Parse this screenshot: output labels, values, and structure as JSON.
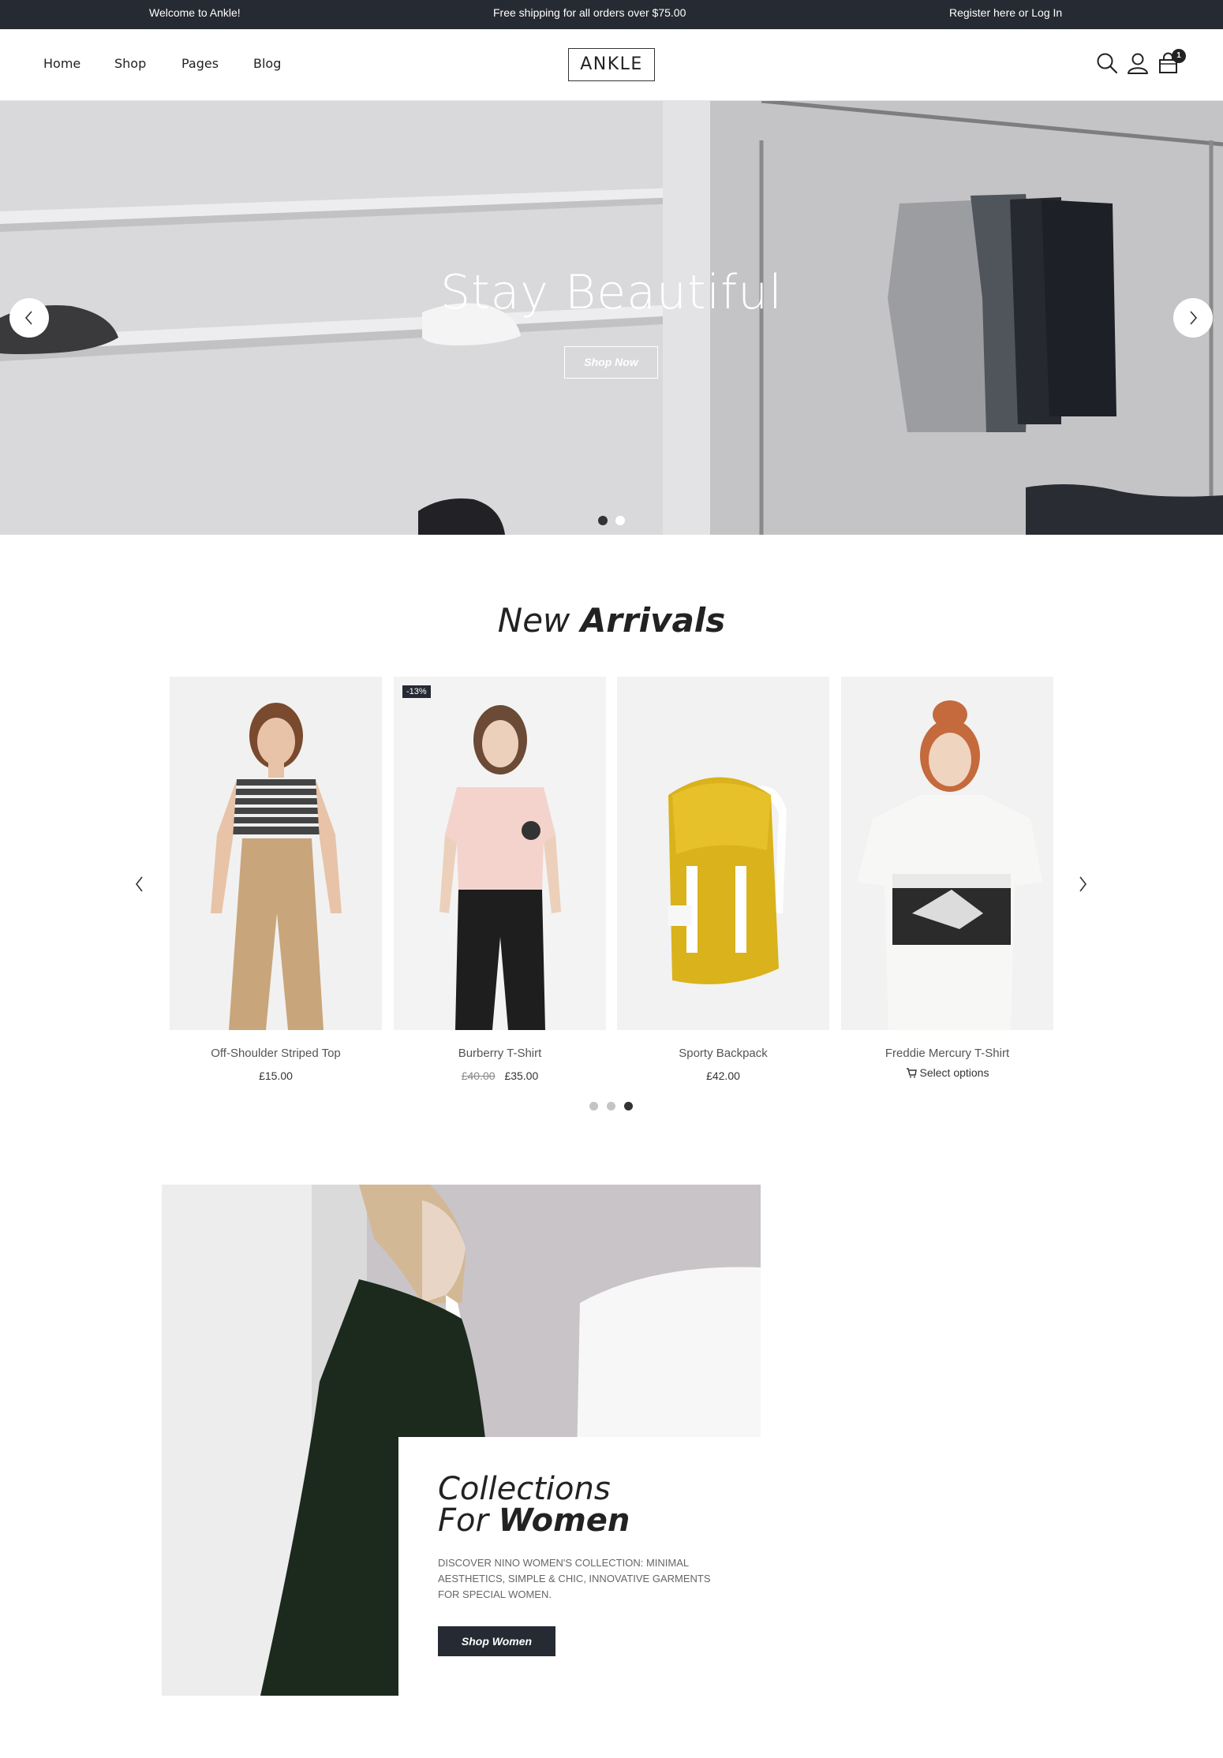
{
  "topbar": {
    "welcome": "Welcome to Ankle!",
    "shipping": "Free shipping for all orders over $75.00",
    "account": "Register here or Log In"
  },
  "header": {
    "nav": [
      "Home",
      "Shop",
      "Pages",
      "Blog"
    ],
    "logo": "ANKLE",
    "icons": [
      "search-icon",
      "user-icon",
      "cart-icon"
    ],
    "cart_count": "1"
  },
  "hero": {
    "title": "Stay Beautiful",
    "button": "Shop Now",
    "slides": 2,
    "active_slide": 2
  },
  "arrivals": {
    "title_light": "New",
    "title_bold": "Arrivals",
    "products": [
      {
        "name": "Off-Shoulder Striped Top",
        "price": "£15.00"
      },
      {
        "name": "Burberry T-Shirt",
        "old_price": "£40.00",
        "price": "£35.00",
        "badge": "-13%"
      },
      {
        "name": "Sporty Backpack",
        "price": "£42.00"
      },
      {
        "name": "Freddie Mercury T-Shirt",
        "action": "Select options"
      }
    ],
    "pages": 3,
    "active_page": 3
  },
  "collection": {
    "title_line1": "Collections",
    "title_line2_light": "For",
    "title_line2_bold": "Women",
    "description": "DISCOVER NINO WOMEN'S COLLECTION: MINIMAL AESTHETICS, SIMPLE & CHIC, INNOVATIVE GARMENTS FOR SPECIAL WOMEN.",
    "button": "Shop Women"
  },
  "colors": {
    "dark": "#262a33",
    "accent": "#222222"
  }
}
